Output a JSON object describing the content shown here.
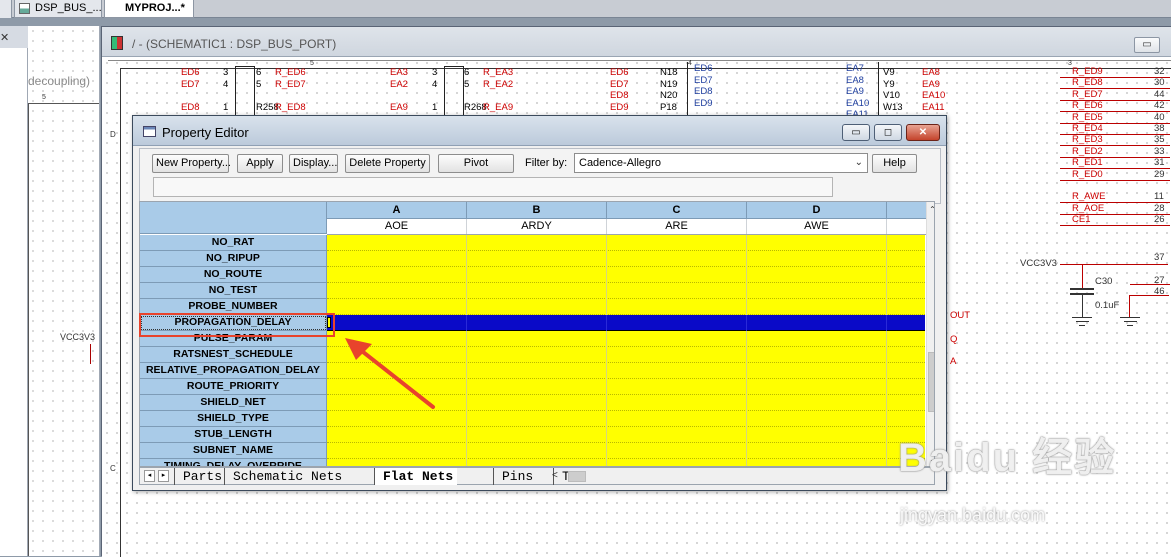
{
  "doc_tabs": [
    {
      "label": "DSP_BUS_...",
      "active": false
    },
    {
      "label": "MYPROJ...*",
      "active": true
    }
  ],
  "left_window": {
    "close_glyph": "✕",
    "subtitle": "decoupling)",
    "ruler_mark": "5",
    "net_label": "VCC3V3"
  },
  "schematic": {
    "title": "/ - (SCHEMATIC1 : DSP_BUS_PORT)",
    "ruler": [
      "5",
      "4",
      "3"
    ],
    "left_marks": [
      "D",
      "C"
    ],
    "sym1": {
      "nets_left": "ED6\nED7\n\nED8",
      "pins_left": "3\n4\n\n1",
      "pins_right": "6\n5\n\nR258",
      "nets_right": "R_ED6\nR_ED7\n\nR_ED8"
    },
    "sym2": {
      "nets_left": "EA3\nEA2\n\nEA9",
      "pins_left": "3\n4\n\n1",
      "pins_right": "6\n5\n\nR268",
      "nets_right": "R_EA3\nR_EA2\n\nR_EA9"
    },
    "sym3": {
      "nets": "ED6\nED7\nED8\nED9",
      "pins": "N18\nN19\nN20\nP18",
      "bus": "ED6\nED7\nED8\nED9"
    },
    "sym4": {
      "bus": "EA7\nEA8\nEA9\nEA10\nEA11",
      "pins": "V9\nY9\nV10\nW13",
      "nets": "EA8\nEA9\nEA10\nEA11"
    },
    "right_nets": [
      "R_ED9",
      "R_ED8",
      "R_ED7",
      "R_ED6",
      "R_ED5",
      "R_ED4",
      "R_ED3",
      "R_ED2",
      "R_ED1",
      "R_ED0",
      "",
      "R_AWE",
      "R_AOE",
      "CE1"
    ],
    "right_pins": [
      "32",
      "30",
      "44",
      "42",
      "40",
      "38",
      "35",
      "33",
      "31",
      "29",
      "",
      "11",
      "28",
      "26"
    ],
    "mid_fragments": [
      "OUT",
      "Q",
      "A"
    ],
    "vcc_label": "VCC3V3",
    "cap_ref": "C30",
    "cap_value": "0.1uF",
    "pin_37": "37",
    "pin_27": "27",
    "pin_46": "46"
  },
  "property_editor": {
    "title": "Property Editor",
    "window_controls": {
      "minimize": "▭",
      "restore": "◻",
      "close": "✕"
    },
    "toolbar": {
      "new_property": "New Property...",
      "apply": "Apply",
      "display": "Display...",
      "delete_property": "Delete Property",
      "pivot": "Pivot",
      "filter_label": "Filter by:",
      "filter_value": "Cadence-Allegro",
      "help": "Help"
    },
    "columns": [
      {
        "letter": "A",
        "name": "AOE"
      },
      {
        "letter": "B",
        "name": "ARDY"
      },
      {
        "letter": "C",
        "name": "ARE"
      },
      {
        "letter": "D",
        "name": "AWE"
      }
    ],
    "rows": [
      "NO_RAT",
      "NO_RIPUP",
      "NO_ROUTE",
      "NO_TEST",
      "PROBE_NUMBER",
      "PROPAGATION_DELAY",
      "PULSE_PARAM",
      "RATSNEST_SCHEDULE",
      "RELATIVE_PROPAGATION_DELAY",
      "ROUTE_PRIORITY",
      "SHIELD_NET",
      "SHIELD_TYPE",
      "STUB_LENGTH",
      "SUBNET_NAME",
      "TIMING_DELAY_OVERRIDE"
    ],
    "selected_row": "PROPAGATION_DELAY",
    "sheet_tabs": [
      {
        "label": "Parts",
        "active": false
      },
      {
        "label": "Schematic Nets",
        "active": false
      },
      {
        "label": "Flat Nets",
        "active": true
      },
      {
        "label": "Pins",
        "active": false
      },
      {
        "label": "T",
        "active": false
      }
    ],
    "sheet_nav": [
      "◂",
      "▸"
    ],
    "scroll_up": "⌃",
    "scroll_down": "⌄",
    "scroll_left": "<"
  },
  "watermark": {
    "main": "Baidu 经验",
    "sub": "jingyan.baidu.com"
  },
  "colors": {
    "cell_yellow": "#ffff00",
    "selected_row": "#0a0ac8",
    "header_blue": "#a9cbe8",
    "annotation_red": "#e8432c",
    "net_red": "#cc0000"
  }
}
